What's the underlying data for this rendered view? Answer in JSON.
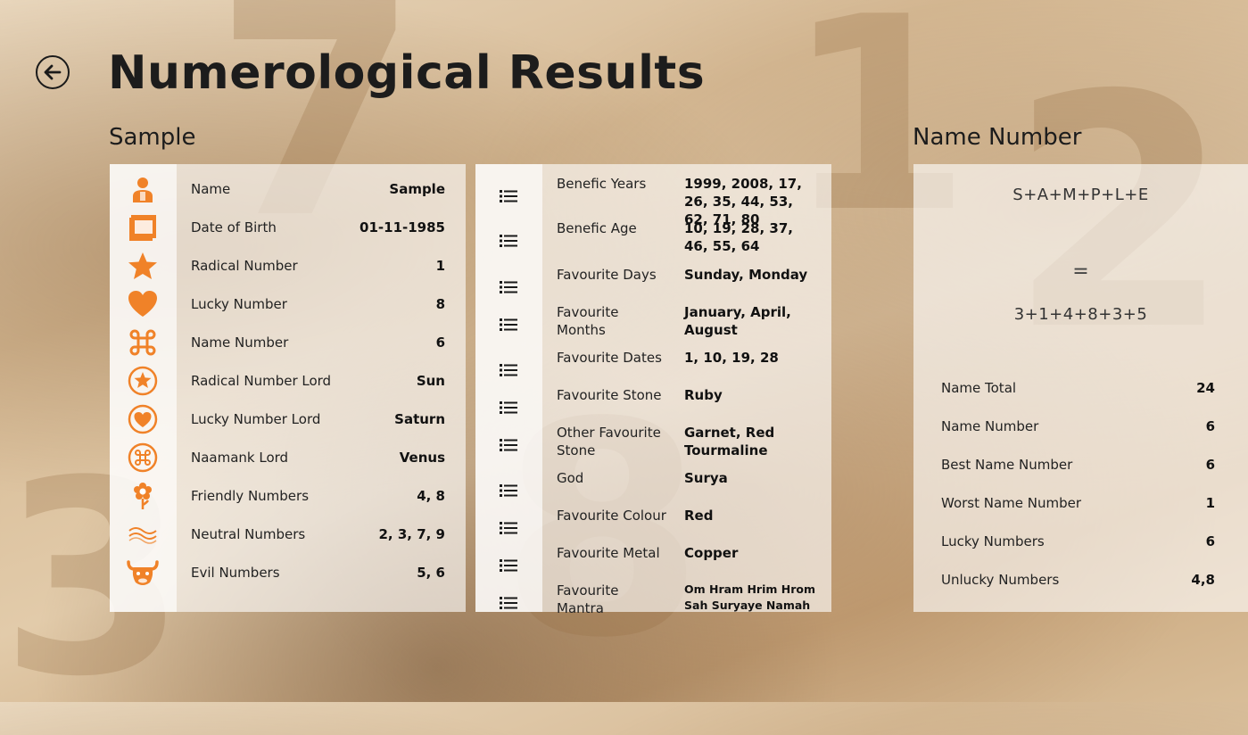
{
  "header": {
    "title": "Numerological Results"
  },
  "sample": {
    "title": "Sample",
    "rows": [
      {
        "icon": "person-icon",
        "label": "Name",
        "value": "Sample"
      },
      {
        "icon": "calendar-icon",
        "label": "Date of Birth",
        "value": "01-11-1985"
      },
      {
        "icon": "star-icon",
        "label": "Radical Number",
        "value": "1"
      },
      {
        "icon": "heart-icon",
        "label": "Lucky Number",
        "value": "8"
      },
      {
        "icon": "command-icon",
        "label": "Name Number",
        "value": "6"
      },
      {
        "icon": "star-circle-icon",
        "label": "Radical Number Lord",
        "value": "Sun"
      },
      {
        "icon": "heart-circle-icon",
        "label": "Lucky Number Lord",
        "value": "Saturn"
      },
      {
        "icon": "command-circle-icon",
        "label": "Naamank Lord",
        "value": "Venus"
      },
      {
        "icon": "flower-icon",
        "label": "Friendly Numbers",
        "value": "4, 8"
      },
      {
        "icon": "waves-icon",
        "label": "Neutral Numbers",
        "value": "2, 3, 7, 9"
      },
      {
        "icon": "bull-icon",
        "label": "Evil Numbers",
        "value": "5, 6"
      }
    ]
  },
  "details": {
    "rows": [
      {
        "label": "Benefic Years",
        "value": "1999, 2008, 17, 26, 35, 44, 53, 62, 71, 80"
      },
      {
        "label": "Benefic Age",
        "value": "10, 19, 28, 37, 46, 55, 64"
      },
      {
        "label": "Favourite Days",
        "value": "Sunday, Monday"
      },
      {
        "label": "Favourite Months",
        "value": "January, April, August"
      },
      {
        "label": "Favourite Dates",
        "value": "1, 10, 19, 28"
      },
      {
        "label": "Favourite Stone",
        "value": "Ruby"
      },
      {
        "label": "Other Favourite Stone",
        "value": "Garnet, Red Tourmaline"
      },
      {
        "label": "God",
        "value": "Surya"
      },
      {
        "label": "Favourite Colour",
        "value": "Red"
      },
      {
        "label": "Favourite Metal",
        "value": "Copper"
      },
      {
        "label": "Favourite Mantra",
        "value": "Om Hram Hrim Hrom Sah Suryaye Namah"
      }
    ]
  },
  "name_number": {
    "title": "Name Number",
    "letters": "S+A+M+P+L+E",
    "equals": "=",
    "digits": "3+1+4+8+3+5",
    "rows": [
      {
        "label": "Name Total",
        "value": "24"
      },
      {
        "label": "Name Number",
        "value": "6"
      },
      {
        "label": "Best Name Number",
        "value": "6"
      },
      {
        "label": "Worst Name Number",
        "value": "1"
      },
      {
        "label": "Lucky Numbers",
        "value": "6"
      },
      {
        "label": "Unlucky Numbers",
        "value": "4,8"
      }
    ]
  },
  "colors": {
    "accent": "#f08228"
  }
}
